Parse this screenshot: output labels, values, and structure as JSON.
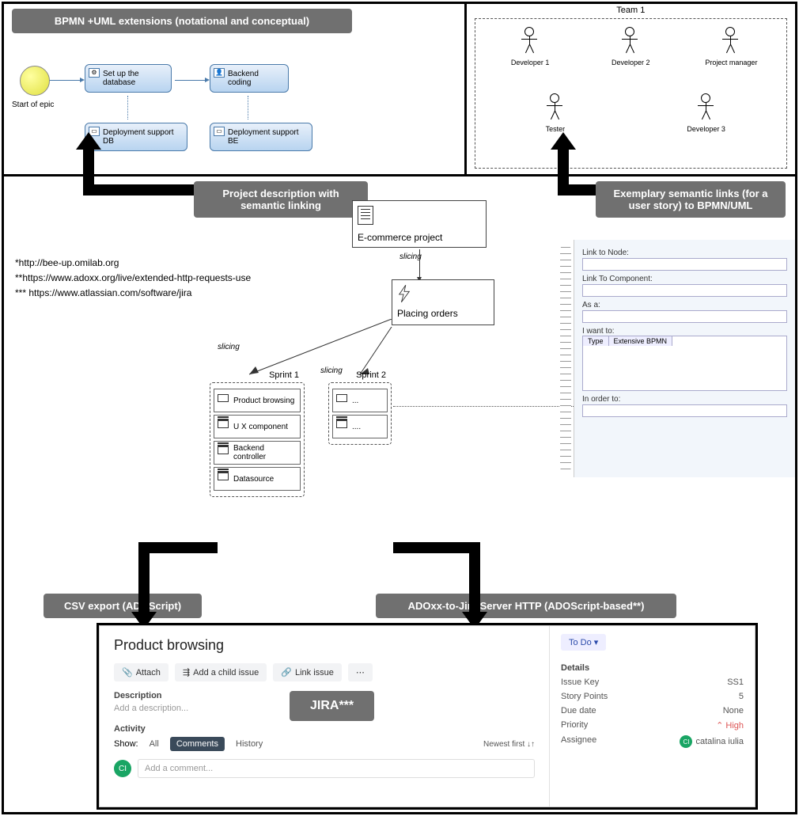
{
  "banners": {
    "bpmn": "BPMN +UML extensions (notational and conceptual)",
    "proj_desc": "Project description with semantic linking",
    "sem_links": "Exemplary semantic links (for a user story) to BPMN/UML",
    "csv": "CSV export (ADOScript)",
    "http": "ADOxx-to-Jira Server HTTP (ADOScript-based**)",
    "jira_overlay": "JIRA***"
  },
  "bpmn": {
    "start_label": "Start of epic",
    "task_setup": "Set up the database",
    "task_backend": "Backend coding",
    "task_deploy_db": "Deployment support DB",
    "task_deploy_be": "Deployment support BE"
  },
  "team": {
    "title": "Team 1",
    "members": [
      "Developer 1",
      "Developer 2",
      "Project manager",
      "Tester",
      "Developer 3"
    ]
  },
  "urls": {
    "u1": "*http://bee-up.omilab.org",
    "u2": "**https://www.adoxx.org/live/extended-http-requests-use",
    "u3": "*** https://www.atlassian.com/software/jira"
  },
  "project": {
    "name": "E-commerce project",
    "epic": "Placing orders",
    "slicing": "slicing",
    "sprint1_label": "Sprint 1",
    "sprint2_label": "Sprint 2",
    "sprint1_items": [
      "Product browsing",
      "U X component",
      "Backend controller",
      "Datasource"
    ],
    "sprint2_items": [
      "...",
      "...."
    ]
  },
  "form": {
    "link_node": "Link to Node:",
    "link_comp": "Link To Component:",
    "as_a": "As a:",
    "i_want": "I want to:",
    "type_col": "Type",
    "bpmn_col": "Extensive BPMN",
    "in_order": "In order to:"
  },
  "jira": {
    "title": "Product browsing",
    "attach": "Attach",
    "add_child": "Add a child issue",
    "link_issue": "Link issue",
    "ellipsis": "⋯",
    "desc_label": "Description",
    "desc_placeholder": "Add a description...",
    "activity_label": "Activity",
    "show": "Show:",
    "tab_all": "All",
    "tab_comments": "Comments",
    "tab_history": "History",
    "newest": "Newest first ↓↑",
    "comment_placeholder": "Add a comment...",
    "todo": "To Do ▾",
    "details": "Details",
    "issue_key_label": "Issue Key",
    "issue_key": "SS1",
    "story_points_label": "Story Points",
    "story_points": "5",
    "due_label": "Due date",
    "due": "None",
    "priority_label": "Priority",
    "priority": "High",
    "assignee_label": "Assignee",
    "assignee": "catalina iulia",
    "avatar_initials": "CI"
  }
}
